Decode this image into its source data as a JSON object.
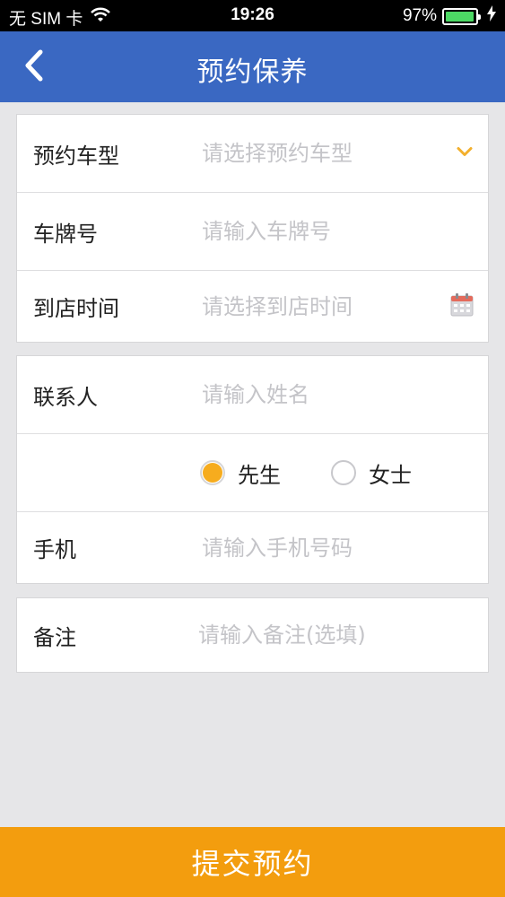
{
  "status_bar": {
    "carrier": "无 SIM 卡",
    "time": "19:26",
    "battery_percent": "97%",
    "battery_level": 0.97
  },
  "nav": {
    "title": "预约保养",
    "color": "#3a68c2"
  },
  "vehicle": {
    "model_label": "预约车型",
    "model_placeholder": "请选择预约车型",
    "plate_label": "车牌号",
    "plate_placeholder": "请输入车牌号",
    "time_label": "到店时间",
    "time_placeholder": "请选择到店时间"
  },
  "contact": {
    "name_label": "联系人",
    "name_placeholder": "请输入姓名",
    "gender_options": [
      "先生",
      "女士"
    ],
    "gender_selected": "先生",
    "phone_label": "手机",
    "phone_placeholder": "请输入手机号码"
  },
  "remark": {
    "label": "备注",
    "placeholder": "请输入备注(选填)"
  },
  "submit": {
    "label": "提交预约",
    "color": "#f39d0e"
  },
  "icons": {
    "back": "chevron-left-icon",
    "dropdown": "chevron-down-icon",
    "calendar": "calendar-icon",
    "wifi": "wifi-icon",
    "battery": "battery-icon",
    "charging": "bolt-icon"
  }
}
